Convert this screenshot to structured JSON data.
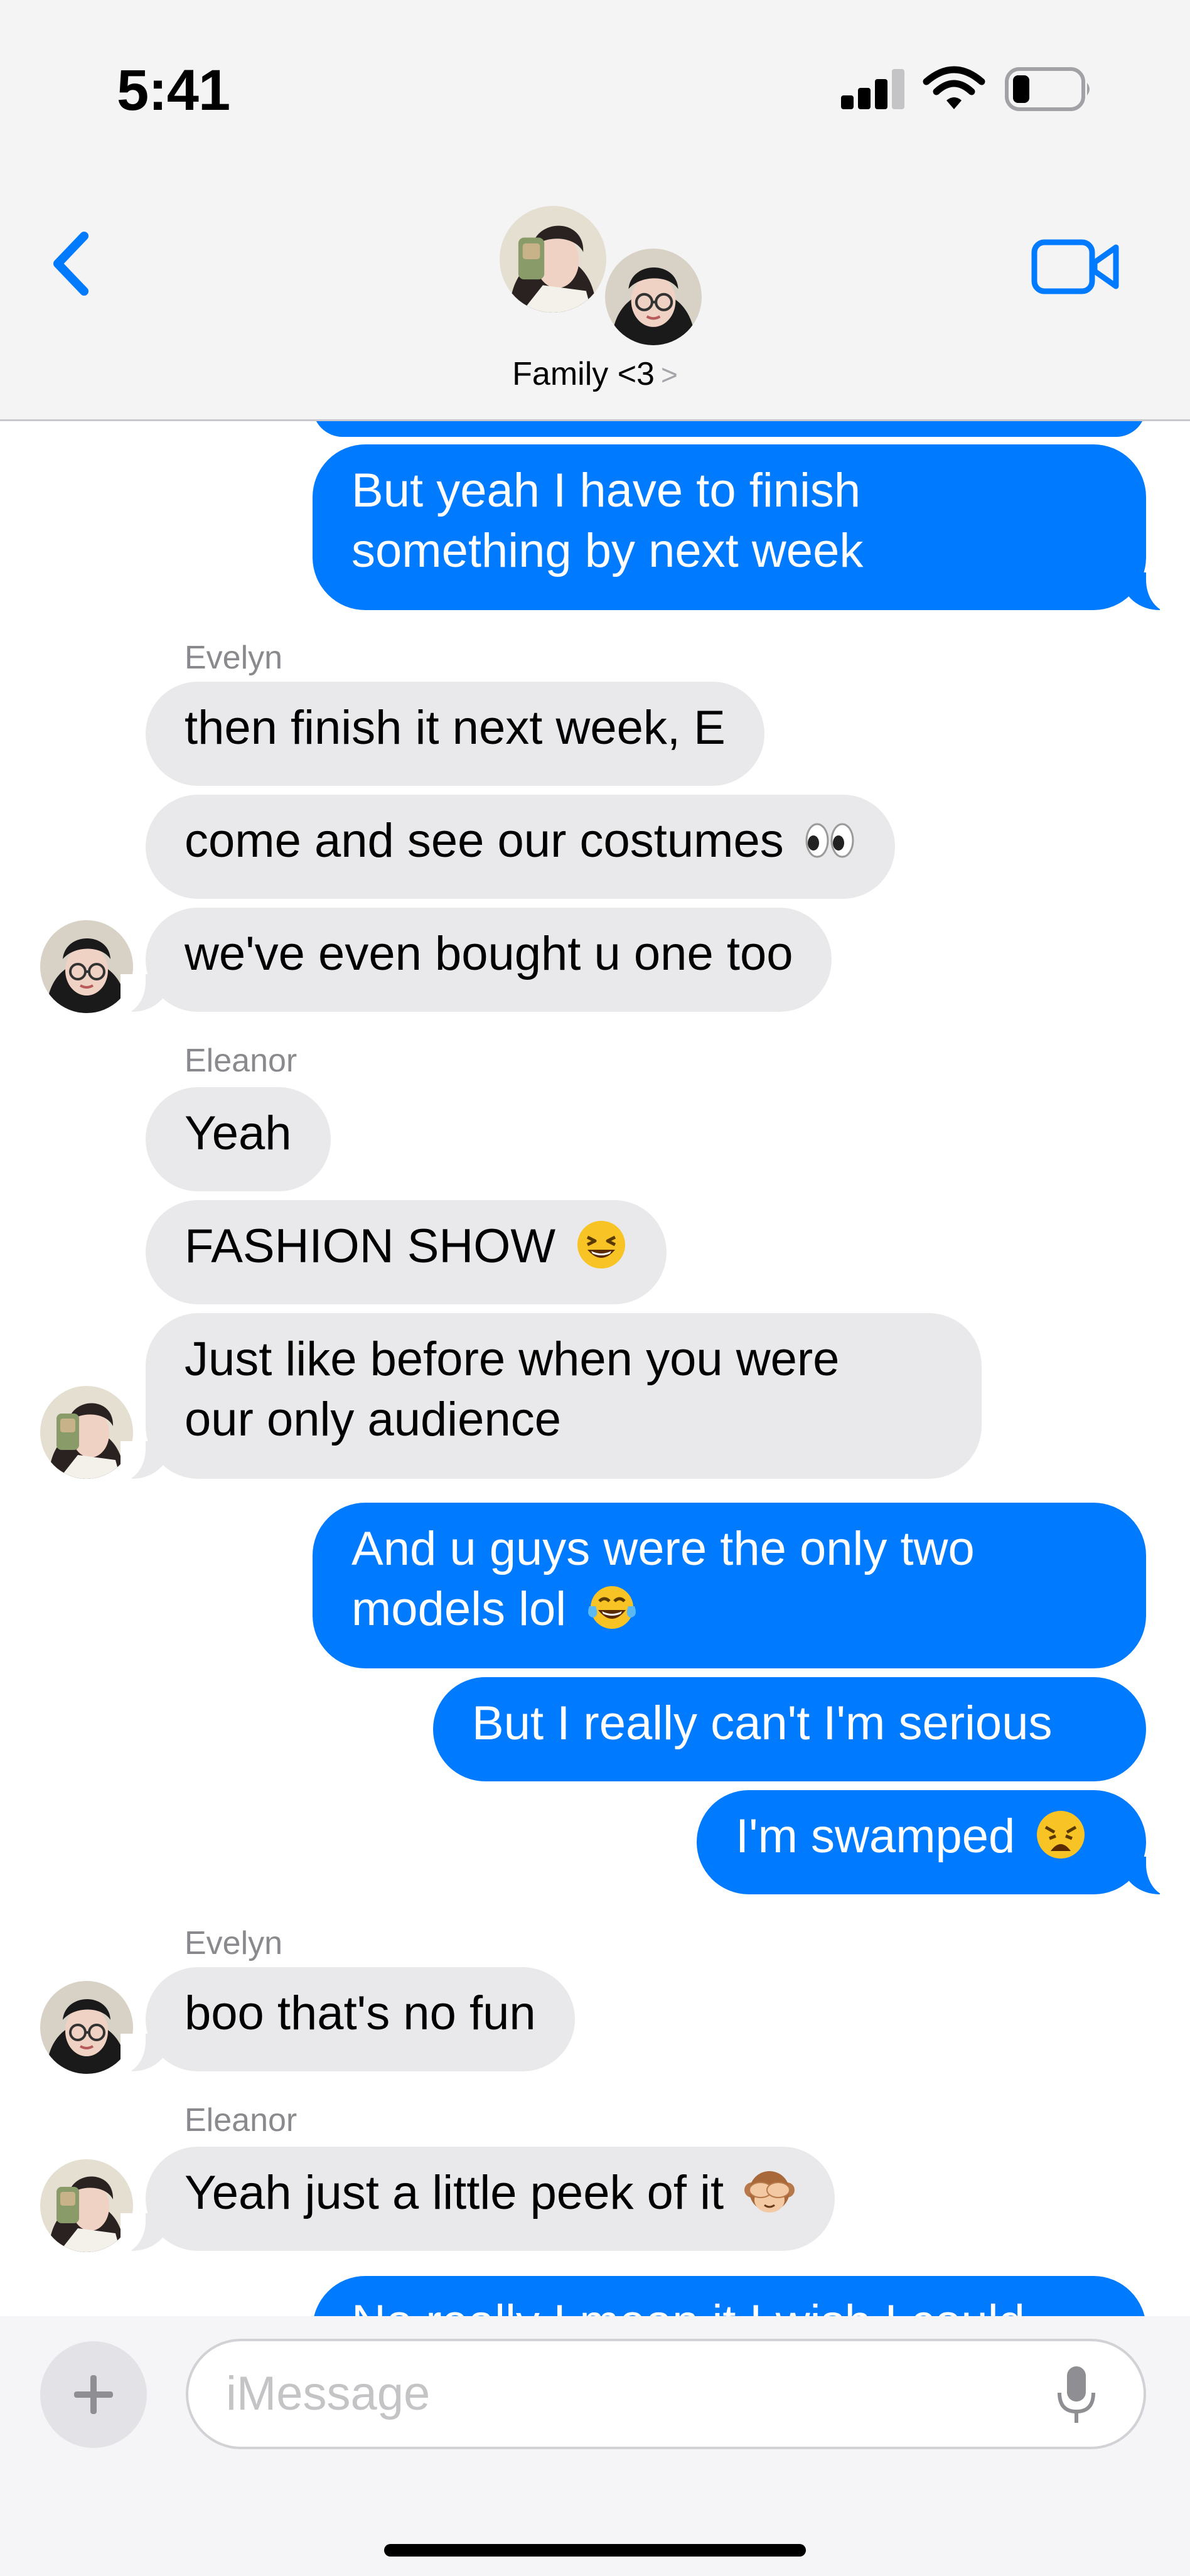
{
  "status_bar": {
    "time": "5:41"
  },
  "header": {
    "group_name": "Family <3",
    "chevron": ">"
  },
  "messages": [
    {
      "text": "But yeah I have to finish\nsomething by next week"
    },
    {
      "sender": "Evelyn",
      "text": "then finish it next week, E"
    },
    {
      "text": "come and see our costumes"
    },
    {
      "text": "we've even bought u one too"
    },
    {
      "sender": "Eleanor",
      "text": "Yeah"
    },
    {
      "text": "FASHION SHOW"
    },
    {
      "line1": "Just like before when you were",
      "line2": "our only audience"
    },
    {
      "line1": "And u guys were the only two",
      "line2": "models lol"
    },
    {
      "text": "But I really can't I'm serious"
    },
    {
      "text": "I'm swamped"
    },
    {
      "sender": "Evelyn",
      "text": "boo that's no fun"
    },
    {
      "sender": "Eleanor",
      "text": "Yeah just a little peek of it"
    },
    {
      "text": "No really I mean it I wish I could"
    }
  ],
  "composer": {
    "placeholder": "iMessage"
  },
  "colors": {
    "outgoing": "#007aff",
    "incoming": "#e9e9eb",
    "accent": "#007aff"
  },
  "icons": [
    "back-chevron-icon",
    "video-camera-icon",
    "plus-icon",
    "microphone-icon",
    "signal-icon",
    "wifi-icon",
    "battery-icon"
  ]
}
